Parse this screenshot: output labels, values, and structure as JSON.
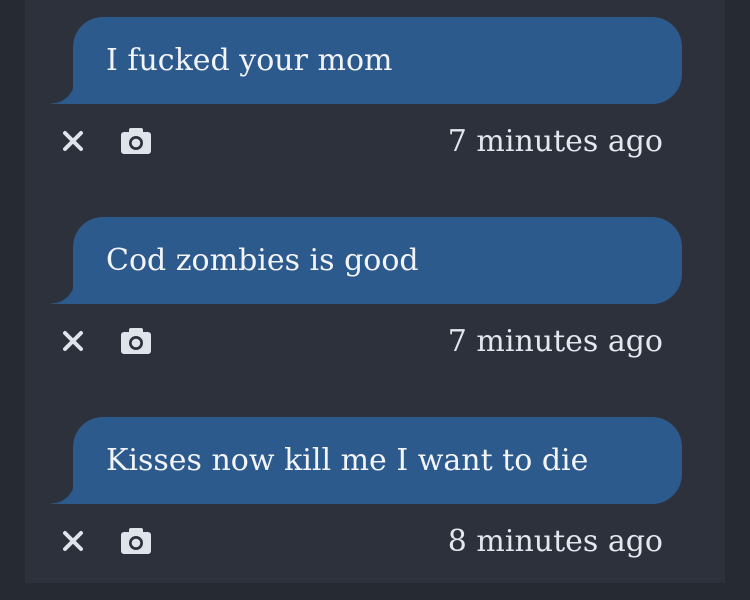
{
  "messages": [
    {
      "text": "I fucked your mom",
      "time": "7 minutes ago"
    },
    {
      "text": "Cod zombies is good",
      "time": "7 minutes ago"
    },
    {
      "text": "Kisses now kill me I want to die",
      "time": "8 minutes ago"
    }
  ],
  "icons": {
    "delete": "close-icon",
    "photo": "camera-icon"
  },
  "colors": {
    "background": "#262a33",
    "panel": "#2d313c",
    "bubble": "#2d5a8c",
    "bubble_text": "#f2f4f8",
    "meta_text": "#e3e7ee",
    "icon": "#dfe3ea"
  }
}
